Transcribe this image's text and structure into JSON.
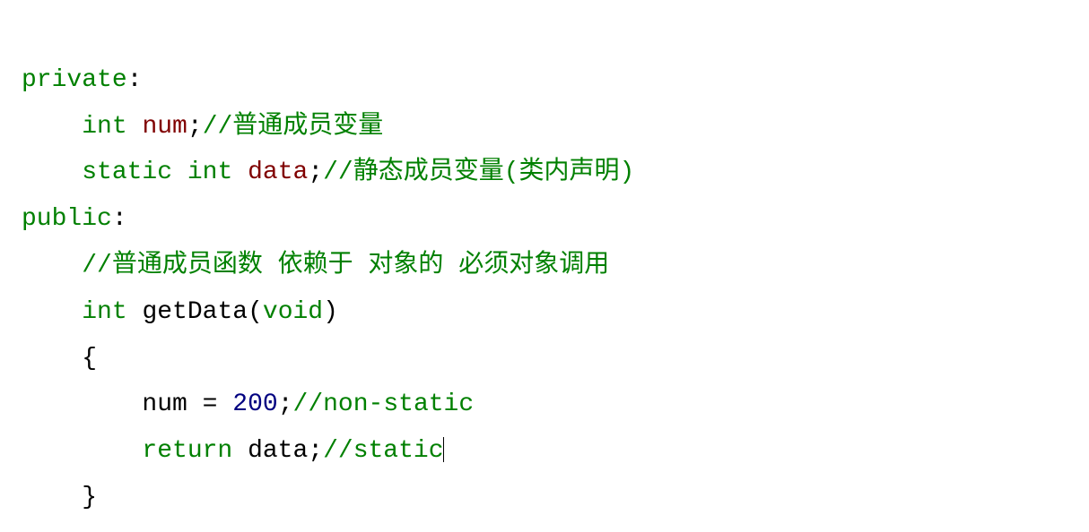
{
  "code": {
    "line1": {
      "kw_private": "private",
      "colon": ":"
    },
    "line2": {
      "indent": "    ",
      "type_int": "int",
      "space": " ",
      "id_num": "num",
      "semi": ";",
      "comment": "//普通成员变量"
    },
    "line3": {
      "indent": "    ",
      "kw_static": "static",
      "space1": " ",
      "type_int": "int",
      "space2": " ",
      "id_data": "data",
      "semi": ";",
      "comment": "//静态成员变量(类内声明)"
    },
    "line4": {
      "kw_public": "public",
      "colon": ":"
    },
    "line5": {
      "indent": "    ",
      "comment": "//普通成员函数 依赖于 对象的 必须对象调用"
    },
    "line6": {
      "indent": "    ",
      "type_int": "int",
      "space": " ",
      "fn_name": "getData",
      "lparen": "(",
      "type_void": "void",
      "rparen": ")"
    },
    "line7": {
      "indent": "    ",
      "brace": "{"
    },
    "line8": {
      "indent": "        ",
      "id_num": "num",
      "space1": " ",
      "eq": "=",
      "space2": " ",
      "val": "200",
      "semi": ";",
      "comment": "//non-static"
    },
    "line9": {
      "indent": "        ",
      "kw_return": "return",
      "space": " ",
      "id_data": "data",
      "semi": ";",
      "comment": "//static"
    },
    "line10": {
      "indent": "    ",
      "brace": "}"
    }
  }
}
